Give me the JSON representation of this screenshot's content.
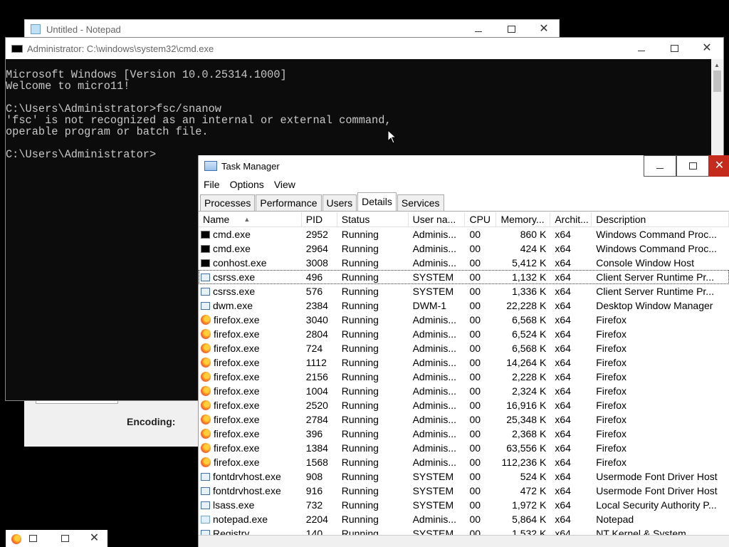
{
  "notepad": {
    "title": "Untitled - Notepad",
    "encoding_label": "Encoding:"
  },
  "cmd": {
    "title": "Administrator: C:\\windows\\system32\\cmd.exe",
    "lines": [
      "Microsoft Windows [Version 10.0.25314.1000]",
      "Welcome to micro11!",
      "",
      "C:\\Users\\Administrator>fsc/snanow",
      "'fsc' is not recognized as an internal or external command,",
      "operable program or batch file.",
      "",
      "C:\\Users\\Administrator>"
    ]
  },
  "taskmanager": {
    "title": "Task Manager",
    "menu": [
      "File",
      "Options",
      "View"
    ],
    "tabs": [
      "Processes",
      "Performance",
      "Users",
      "Details",
      "Services"
    ],
    "active_tab": "Details",
    "columns": [
      "Name",
      "PID",
      "Status",
      "User na...",
      "CPU",
      "Memory...",
      "Archit...",
      "Description"
    ],
    "rows": [
      {
        "icon": "cmd",
        "name": "cmd.exe",
        "pid": "2952",
        "status": "Running",
        "user": "Adminis...",
        "cpu": "00",
        "mem": "860 K",
        "arch": "x64",
        "desc": "Windows Command Proc..."
      },
      {
        "icon": "cmd",
        "name": "cmd.exe",
        "pid": "2964",
        "status": "Running",
        "user": "Adminis...",
        "cpu": "00",
        "mem": "424 K",
        "arch": "x64",
        "desc": "Windows Command Proc..."
      },
      {
        "icon": "cmd",
        "name": "conhost.exe",
        "pid": "3008",
        "status": "Running",
        "user": "Adminis...",
        "cpu": "00",
        "mem": "5,412 K",
        "arch": "x64",
        "desc": "Console Window Host"
      },
      {
        "icon": "sys",
        "name": "csrss.exe",
        "pid": "496",
        "status": "Running",
        "user": "SYSTEM",
        "cpu": "00",
        "mem": "1,132 K",
        "arch": "x64",
        "desc": "Client Server Runtime Pr...",
        "selected": true
      },
      {
        "icon": "sys",
        "name": "csrss.exe",
        "pid": "576",
        "status": "Running",
        "user": "SYSTEM",
        "cpu": "00",
        "mem": "1,336 K",
        "arch": "x64",
        "desc": "Client Server Runtime Pr..."
      },
      {
        "icon": "sys",
        "name": "dwm.exe",
        "pid": "2384",
        "status": "Running",
        "user": "DWM-1",
        "cpu": "00",
        "mem": "22,228 K",
        "arch": "x64",
        "desc": "Desktop Window Manager"
      },
      {
        "icon": "fox",
        "name": "firefox.exe",
        "pid": "3040",
        "status": "Running",
        "user": "Adminis...",
        "cpu": "00",
        "mem": "6,568 K",
        "arch": "x64",
        "desc": "Firefox"
      },
      {
        "icon": "fox",
        "name": "firefox.exe",
        "pid": "2804",
        "status": "Running",
        "user": "Adminis...",
        "cpu": "00",
        "mem": "6,524 K",
        "arch": "x64",
        "desc": "Firefox"
      },
      {
        "icon": "fox",
        "name": "firefox.exe",
        "pid": "724",
        "status": "Running",
        "user": "Adminis...",
        "cpu": "00",
        "mem": "6,568 K",
        "arch": "x64",
        "desc": "Firefox"
      },
      {
        "icon": "fox",
        "name": "firefox.exe",
        "pid": "1112",
        "status": "Running",
        "user": "Adminis...",
        "cpu": "00",
        "mem": "14,264 K",
        "arch": "x64",
        "desc": "Firefox"
      },
      {
        "icon": "fox",
        "name": "firefox.exe",
        "pid": "2156",
        "status": "Running",
        "user": "Adminis...",
        "cpu": "00",
        "mem": "2,228 K",
        "arch": "x64",
        "desc": "Firefox"
      },
      {
        "icon": "fox",
        "name": "firefox.exe",
        "pid": "1004",
        "status": "Running",
        "user": "Adminis...",
        "cpu": "00",
        "mem": "2,324 K",
        "arch": "x64",
        "desc": "Firefox"
      },
      {
        "icon": "fox",
        "name": "firefox.exe",
        "pid": "2520",
        "status": "Running",
        "user": "Adminis...",
        "cpu": "00",
        "mem": "16,916 K",
        "arch": "x64",
        "desc": "Firefox"
      },
      {
        "icon": "fox",
        "name": "firefox.exe",
        "pid": "2784",
        "status": "Running",
        "user": "Adminis...",
        "cpu": "00",
        "mem": "25,348 K",
        "arch": "x64",
        "desc": "Firefox"
      },
      {
        "icon": "fox",
        "name": "firefox.exe",
        "pid": "396",
        "status": "Running",
        "user": "Adminis...",
        "cpu": "00",
        "mem": "2,368 K",
        "arch": "x64",
        "desc": "Firefox"
      },
      {
        "icon": "fox",
        "name": "firefox.exe",
        "pid": "1384",
        "status": "Running",
        "user": "Adminis...",
        "cpu": "00",
        "mem": "63,556 K",
        "arch": "x64",
        "desc": "Firefox"
      },
      {
        "icon": "fox",
        "name": "firefox.exe",
        "pid": "1568",
        "status": "Running",
        "user": "Adminis...",
        "cpu": "00",
        "mem": "112,236 K",
        "arch": "x64",
        "desc": "Firefox"
      },
      {
        "icon": "sys",
        "name": "fontdrvhost.exe",
        "pid": "908",
        "status": "Running",
        "user": "SYSTEM",
        "cpu": "00",
        "mem": "524 K",
        "arch": "x64",
        "desc": "Usermode Font Driver Host"
      },
      {
        "icon": "sys",
        "name": "fontdrvhost.exe",
        "pid": "916",
        "status": "Running",
        "user": "SYSTEM",
        "cpu": "00",
        "mem": "472 K",
        "arch": "x64",
        "desc": "Usermode Font Driver Host"
      },
      {
        "icon": "sys",
        "name": "lsass.exe",
        "pid": "732",
        "status": "Running",
        "user": "SYSTEM",
        "cpu": "00",
        "mem": "1,972 K",
        "arch": "x64",
        "desc": "Local Security Authority P..."
      },
      {
        "icon": "np",
        "name": "notepad.exe",
        "pid": "2204",
        "status": "Running",
        "user": "Adminis...",
        "cpu": "00",
        "mem": "5,864 K",
        "arch": "x64",
        "desc": "Notepad"
      },
      {
        "icon": "sys",
        "name": "Registry",
        "pid": "140",
        "status": "Running",
        "user": "SYSTEM",
        "cpu": "00",
        "mem": "1,532 K",
        "arch": "x64",
        "desc": "NT Kernel & System"
      }
    ]
  },
  "colors": {
    "console_bg": "#0c0c0c",
    "console_fg": "#c8c8c8",
    "close_red": "#c42b1c"
  }
}
